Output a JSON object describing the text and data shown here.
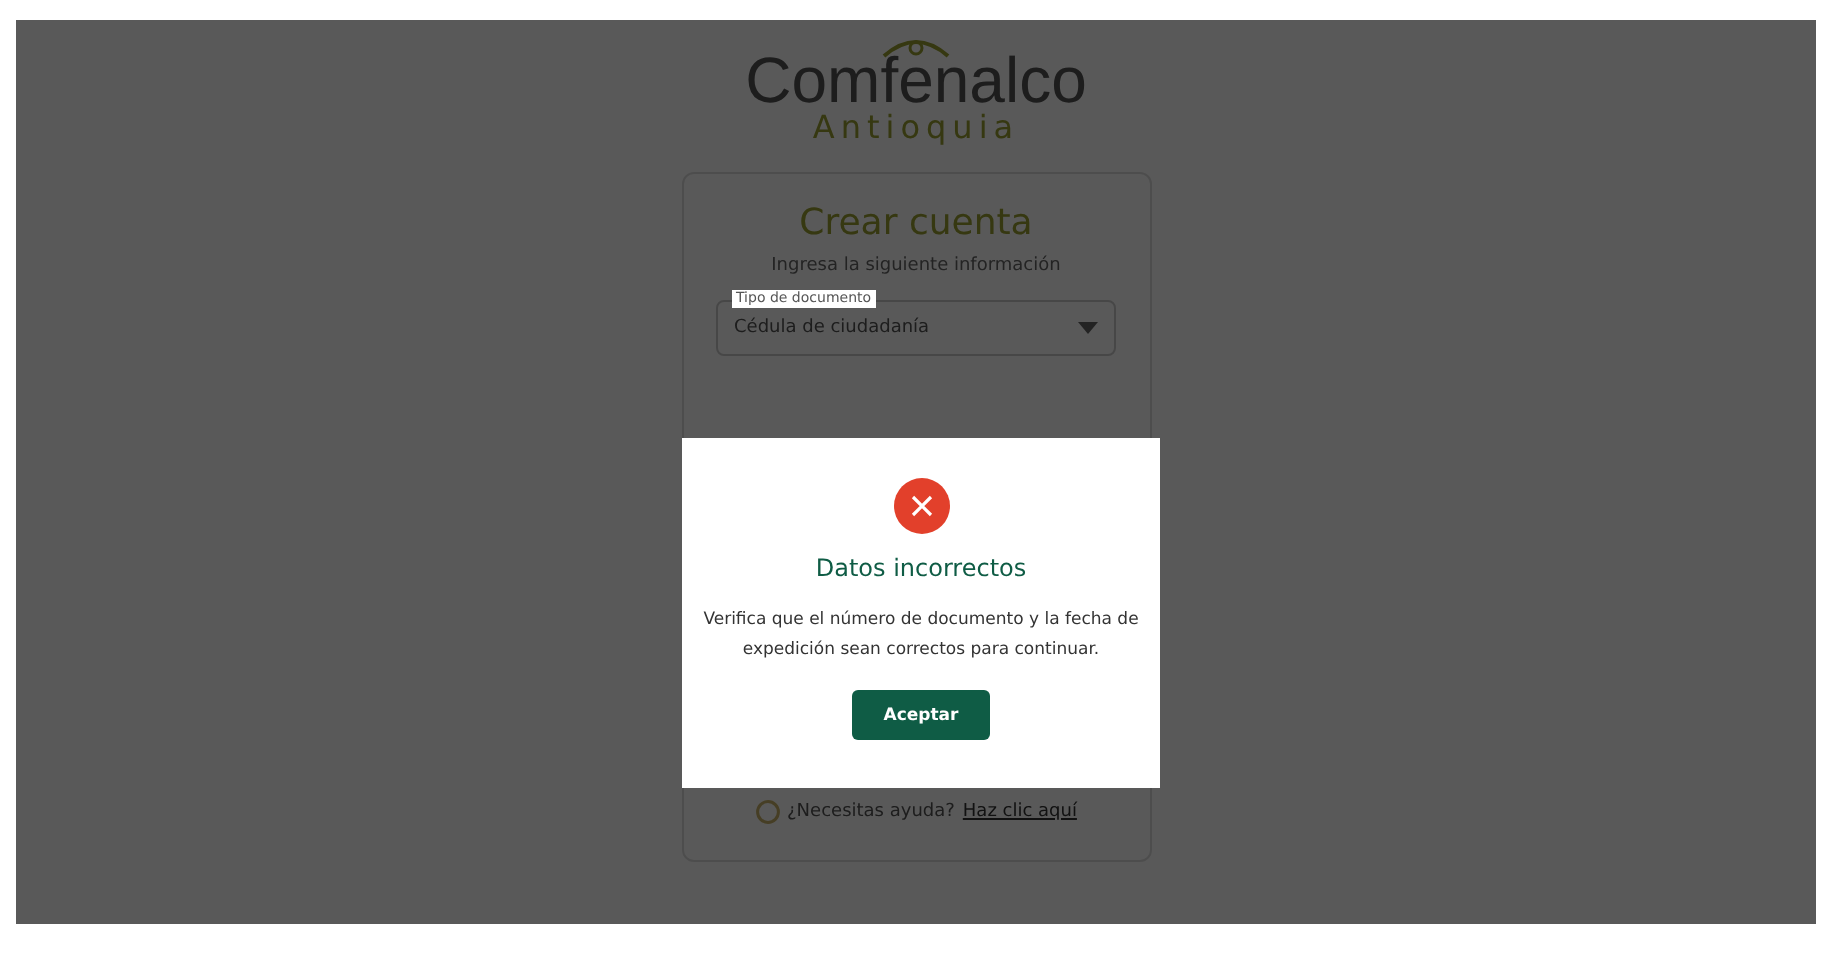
{
  "logo": {
    "name": "Comfenalco",
    "region": "Antioquia"
  },
  "form": {
    "title": "Crear cuenta",
    "subtitle": "Ingresa la siguiente información",
    "document_type": {
      "label": "Tipo de documento",
      "value": "Cédula de ciudadanía"
    },
    "help_text": "¿Necesitas ayuda?",
    "help_link": "Haz clic aquí"
  },
  "dialog": {
    "kind": "error",
    "title": "Datos incorrectos",
    "message": "Verifica que el número de documento y la fecha de expedición sean correctos para continuar.",
    "button": "Aceptar"
  }
}
